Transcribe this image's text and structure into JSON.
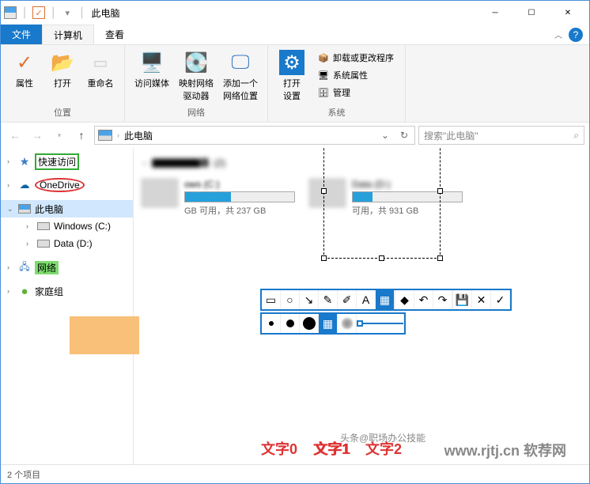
{
  "title": "此电脑",
  "tabs": {
    "file": "文件",
    "computer": "计算机",
    "view": "查看"
  },
  "ribbon": {
    "location": {
      "label": "位置",
      "properties": "属性",
      "open": "打开",
      "rename": "重命名"
    },
    "network": {
      "label": "网络",
      "media": "访问媒体",
      "mapdrive": "映射网络\n驱动器",
      "addloc": "添加一个\n网络位置"
    },
    "system": {
      "label": "系统",
      "opensettings": "打开\n设置",
      "uninstall": "卸载或更改程序",
      "sysprops": "系统属性",
      "manage": "管理"
    }
  },
  "addressbar": {
    "path": "此电脑",
    "search_placeholder": "搜索\"此电脑\""
  },
  "sidebar": {
    "quickaccess": "快速访问",
    "onedrive": "OneDrive",
    "thispc": "此电脑",
    "windows_c": "Windows (C:)",
    "data_d": "Data (D:)",
    "network": "网络",
    "homegroup": "家庭组"
  },
  "drives": {
    "header_count": "(2)",
    "c": {
      "name": "ows (C:)",
      "bar_pct": 42,
      "free": "GB 可用，共 237 GB"
    },
    "d": {
      "name": "Data (D:)",
      "bar_pct": 18,
      "free": "可用，共 931 GB"
    }
  },
  "annotations": {
    "text0": "文字0",
    "text1": "文字1",
    "text2": "文字2"
  },
  "statusbar": {
    "items": "2 个项目"
  },
  "watermark_left": "头条@职场办公技能",
  "watermark_right": "www.rjtj.cn 软荐网"
}
